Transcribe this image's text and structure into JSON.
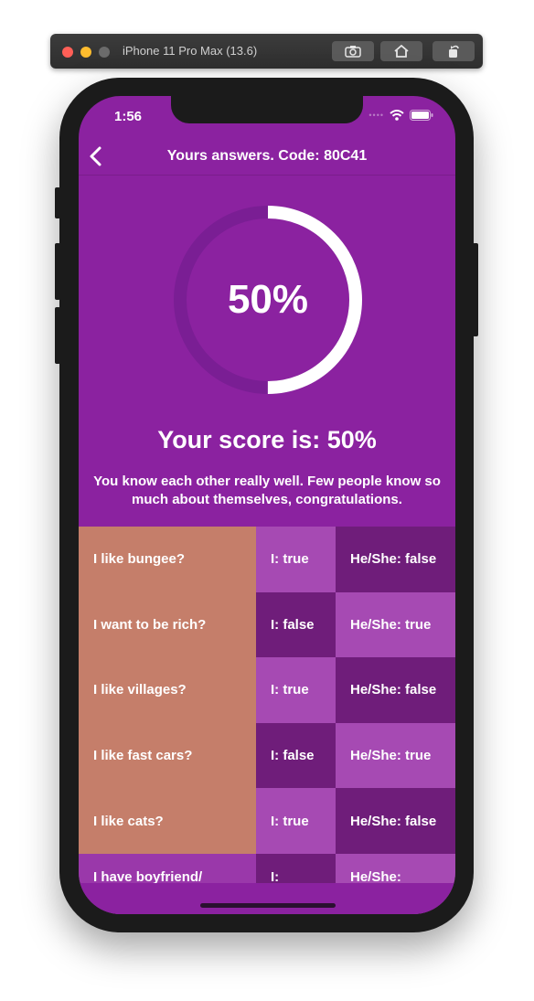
{
  "simulator": {
    "title": "iPhone 11 Pro Max (13.6)"
  },
  "status_bar": {
    "time": "1:56"
  },
  "nav": {
    "title": "Yours answers. Code: 80C41"
  },
  "score": {
    "percent_label": "50%",
    "percent_value": 0.5,
    "headline": "Your score is: 50%",
    "description": "You know each other really well. Few people know so much about themselves, congratulations."
  },
  "answers": [
    {
      "question": "I like bungee?",
      "mine": "I:  true",
      "theirs": "He/She: false"
    },
    {
      "question": "I want to be rich?",
      "mine": "I: false",
      "theirs": "He/She: true"
    },
    {
      "question": "I like villages?",
      "mine": "I:  true",
      "theirs": "He/She: false"
    },
    {
      "question": "I like fast cars?",
      "mine": "I: false",
      "theirs": "He/She: true"
    },
    {
      "question": "I like cats?",
      "mine": "I:  true",
      "theirs": "He/She: false"
    },
    {
      "question": "I have boyfriend/",
      "mine": "I:",
      "theirs": "He/She:"
    }
  ],
  "colors": {
    "background": "#8b22a0",
    "question_cell": "#c57e6a",
    "light_purple": "#a64ab3",
    "dark_purple": "#6f1d7a",
    "ring_track": "#7a1e94"
  },
  "icons": {
    "back": "chevron-left-icon",
    "screenshot": "camera-icon",
    "home": "home-icon",
    "rotate": "rotate-icon",
    "wifi": "wifi-icon",
    "battery": "battery-icon"
  }
}
